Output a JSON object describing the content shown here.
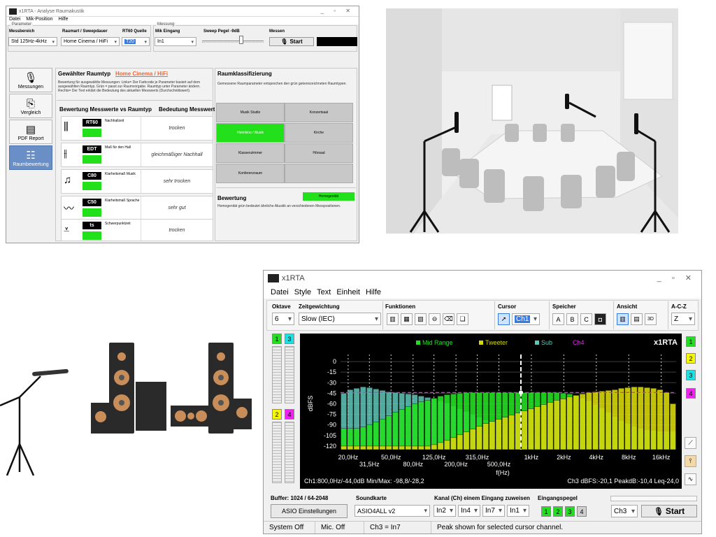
{
  "analysis": {
    "title": "x1RTA - Analyse Raumakustik",
    "menu": [
      "Datei",
      "Mik-Position",
      "Hilfe"
    ],
    "group_params": "Parameter",
    "group_meas": "Messung",
    "labels": {
      "range": "Messbereich",
      "room_sweep": "Raumart / Sweepdauer",
      "rt60_src": "RT60 Quelle",
      "mic_input": "Mik Eingang",
      "sweep_level": "Sweep Pegel -9dB",
      "measure": "Messen"
    },
    "values": {
      "range": "Std 125Hz-4kHz",
      "room": "Home Cinema / HiFi",
      "rt60_src": "T20",
      "mic_input": "In1",
      "start": "Start"
    },
    "nav": [
      {
        "label": "Messungen",
        "icon": "microphone-icon"
      },
      {
        "label": "Vergleich",
        "icon": "compare-icon"
      },
      {
        "label": "PDF Report",
        "icon": "report-icon"
      },
      {
        "label": "Raumbewertung",
        "icon": "rating-list-icon"
      }
    ],
    "room_header": "Gewählter Raumtyp",
    "room_value": "Home Cinema / HiFi",
    "room_desc": "Bewertung für ausgewählte Messungen: Links= Der Farbcode je Parameter basiert auf dem ausgewählten Raumtyp. Grün = passt zur Raumvorgabe. Raumtyp unter Parameter ändern. Rechts= Der Text erklärt die Bedeutung des aktuellen Messwerts (Durchschnittswert).",
    "metrics_header": "Bewertung Messwerte vs Raumtyp",
    "meaning_header": "Bedeutung Messwert",
    "metrics": [
      {
        "abbr": "RT60",
        "name": "Nachhallzeit",
        "eval": "trocken"
      },
      {
        "abbr": "EDT",
        "name": "Maß für den Hall",
        "eval": "gleichmäßiger Nachhall"
      },
      {
        "abbr": "C80",
        "name": "Klarheitsmaß Musik",
        "eval": "sehr trocken"
      },
      {
        "abbr": "C50",
        "name": "Klarheitsmaß Sprache",
        "eval": "sehr gut"
      },
      {
        "abbr": "ts",
        "name": "Schwerpunktzeit",
        "eval": "trocken"
      }
    ],
    "class_header": "Raumklassifizierung",
    "class_desc": "Gemessene Raumparameter entsprechen den grün gekennzeichneten Raumtypen.",
    "rooms": [
      "Musik Studio",
      "Konzertsaal",
      "Heimkino / Musik",
      "Kirche",
      "Klassenzimmer",
      "Hörsaal",
      "Konferenzraum",
      ""
    ],
    "bewertung_header": "Bewertung",
    "bewertung_value": "Homogenität",
    "bewertung_desc": "Homogenität grün bedeutet ähnliche Akustik an verschiedenen Messpositionen."
  },
  "rta": {
    "title": "x1RTA",
    "menu": [
      "Datei",
      "Style",
      "Text",
      "Einheit",
      "Hilfe"
    ],
    "toolbar": {
      "oktave_label": "Oktave",
      "oktave_value": "6",
      "zeit_label": "Zeitgewichtung",
      "zeit_value": "Slow (IEC)",
      "funktionen_label": "Funktionen",
      "cursor_label": "Cursor",
      "cursor_value": "Ch1",
      "speicher_label": "Speicher",
      "speicher": [
        "A",
        "B",
        "C"
      ],
      "ansicht_label": "Ansicht",
      "ansicht_3d": "3D",
      "acz_label": "A-C-Z",
      "acz_value": "Z"
    },
    "channels_left": [
      "1",
      "3",
      "2",
      "4"
    ],
    "channels_right": [
      "1",
      "2",
      "3",
      "4"
    ],
    "legend": [
      "Mid Range",
      "Tweeter",
      "Sub",
      "Ch4"
    ],
    "brand": "x1RTA",
    "readout_left": "Ch1:800,0Hz/-44,0dB Min/Max: -98,8/-28,2",
    "readout_right": "Ch3 dBFS:-20,1 PeakdB:-10,4 Leq-24,0",
    "bottom": {
      "buffer_label": "Buffer: 1024 / 64-2048",
      "asio_button": "ASIO Einstellungen",
      "sound_label": "Soundkarte",
      "sound_value": "ASIO4ALL v2",
      "kanal_label": "Kanal (Ch) einem Eingang zuweisen",
      "kanal": [
        "In2",
        "In4",
        "In7",
        "In1"
      ],
      "pegel_label": "Eingangspegel",
      "pegel": [
        "1",
        "2",
        "3",
        "4"
      ],
      "ch_value": "Ch3",
      "start": "Start"
    },
    "status": [
      "System Off",
      "Mic. Off",
      "Ch3 = In7",
      "Peak shown for selected cursor channel."
    ]
  },
  "chart_data": {
    "type": "bar",
    "title": "",
    "xlabel": "f(Hz)",
    "ylabel": "dBFS",
    "ylim": [
      -125,
      10
    ],
    "yticks": [
      "0",
      "-15",
      "-30",
      "-45",
      "-60",
      "-75",
      "-90",
      "-105",
      "-120"
    ],
    "xticks_top": [
      "20,0Hz",
      "50,0Hz",
      "125,0Hz",
      "315,0Hz",
      "1kHz",
      "2kHz",
      "4kHz",
      "8kHz",
      "16kHz"
    ],
    "xticks_bottom": [
      "31,5Hz",
      "80,0Hz",
      "200,0Hz",
      "500,0Hz"
    ],
    "x_range_hz": [
      17,
      22000
    ],
    "grid": true,
    "cursor_hz": 800,
    "reference_level_db": -44,
    "series": [
      {
        "name": "Mid Range",
        "color": "#22dd22",
        "values": [
          -95,
          -95,
          -95,
          -93,
          -90,
          -86,
          -82,
          -77,
          -72,
          -68,
          -64,
          -60,
          -57,
          -55,
          -52,
          -49,
          -47,
          -46,
          -45,
          -44,
          -44,
          -44,
          -44,
          -44,
          -44,
          -44,
          -44,
          -44,
          -44,
          -44,
          -44,
          -44,
          -44,
          -44,
          -45,
          -46,
          -48,
          -52,
          -56,
          -61,
          -66,
          -72,
          -78,
          -84,
          -88,
          -92,
          -95,
          -97,
          -98,
          -99,
          -99,
          -99
        ]
      },
      {
        "name": "Tweeter",
        "color": "#d6d60a",
        "values": [
          -120,
          -120,
          -120,
          -120,
          -120,
          -120,
          -120,
          -120,
          -120,
          -120,
          -120,
          -120,
          -120,
          -120,
          -118,
          -115,
          -112,
          -108,
          -104,
          -100,
          -96,
          -92,
          -88,
          -85,
          -82,
          -79,
          -76,
          -73,
          -70,
          -67,
          -64,
          -61,
          -58,
          -55,
          -53,
          -50,
          -48,
          -46,
          -44,
          -43,
          -42,
          -41,
          -40,
          -38,
          -37,
          -36,
          -36,
          -37,
          -38,
          -40,
          -44,
          -60
        ]
      },
      {
        "name": "Sub",
        "color": "#5fc8b8",
        "values": [
          -45,
          -40,
          -38,
          -36,
          -37,
          -39,
          -41,
          -43,
          -44,
          -45,
          -46,
          -47,
          -49,
          -51,
          -53,
          -56,
          -59,
          -63,
          -67,
          -71,
          -75,
          -79,
          -83,
          -87,
          -90,
          -93,
          -96,
          -99,
          -102,
          -105,
          -107,
          -109,
          -111,
          -113,
          -114,
          -115,
          -116,
          -117,
          -118,
          -118,
          -119,
          -119,
          -119,
          -120,
          -120,
          -120,
          -120,
          -120,
          -120,
          -120,
          -120,
          -120
        ]
      }
    ]
  }
}
